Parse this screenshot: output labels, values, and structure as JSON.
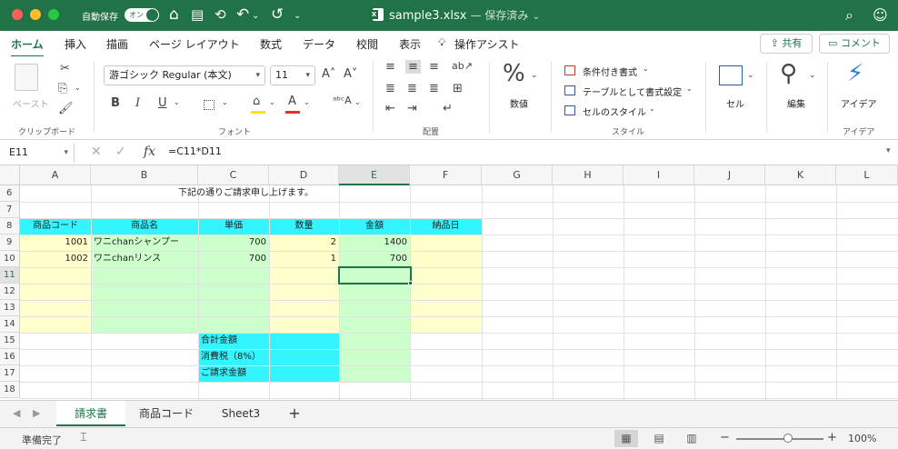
{
  "titlebar": {
    "autosave_label": "自動保存",
    "autosave_state": "オン",
    "filename": "sample3.xlsx",
    "saved_status": "— 保存済み",
    "saved_caret": "⌄"
  },
  "tabs": [
    {
      "label": "ホーム",
      "active": true
    },
    {
      "label": "挿入"
    },
    {
      "label": "描画"
    },
    {
      "label": "ページ レイアウト"
    },
    {
      "label": "数式"
    },
    {
      "label": "データ"
    },
    {
      "label": "校閲"
    },
    {
      "label": "表示"
    },
    {
      "label": "操作アシスト"
    }
  ],
  "share_label": "共有",
  "comment_label": "コメント",
  "ribbon": {
    "paste_label": "ペースト",
    "clipboard_label": "クリップボード",
    "font_name": "游ゴシック Regular (本文)",
    "font_size": "11",
    "font_label": "フォント",
    "bold": "B",
    "italic": "I",
    "underline": "U",
    "align_label": "配置",
    "number_label": "数値",
    "percent_symbol": "%",
    "cond_format": "条件付き書式",
    "table_format": "テーブルとして書式設定",
    "cell_style": "セルのスタイル",
    "style_label": "スタイル",
    "cells_label": "セル",
    "edit_label": "編集",
    "ideas_label": "アイデア",
    "ideas_group_label": "アイデア"
  },
  "formula_bar": {
    "name_box": "E11",
    "formula": "=C11*D11"
  },
  "columns": [
    "A",
    "B",
    "C",
    "D",
    "E",
    "F",
    "G",
    "H",
    "I",
    "J",
    "K",
    "L"
  ],
  "selected_column": "E",
  "rows": [
    "6",
    "7",
    "8",
    "9",
    "10",
    "11",
    "12",
    "13",
    "14",
    "15",
    "16",
    "17",
    "18"
  ],
  "selected_row": "11",
  "cells": {
    "notice": "下記の通りご請求申し上げます。",
    "hdr_code": "商品コード",
    "hdr_name": "商品名",
    "hdr_price": "単価",
    "hdr_qty": "数量",
    "hdr_amount": "金額",
    "hdr_date": "納品日",
    "r9_code": "1001",
    "r9_name": "ワニchanシャンプー",
    "r9_price": "700",
    "r9_qty": "2",
    "r9_amount": "1400",
    "r10_code": "1002",
    "r10_name": "ワニchanリンス",
    "r10_price": "700",
    "r10_qty": "1",
    "r10_amount": "700",
    "subtotal": "合計金額",
    "tax": "消費税（8%）",
    "total": "ご請求金額"
  },
  "sheets": [
    {
      "label": "請求書",
      "active": true
    },
    {
      "label": "商品コード"
    },
    {
      "label": "Sheet3"
    }
  ],
  "add_sheet": "+",
  "status": {
    "ready": "準備完了",
    "zoom": "100%",
    "zoom_fraction": 0.55
  },
  "colors": {
    "accent": "#207346",
    "header_fill": "#33f5ff",
    "yellow_fill": "#ffffcc",
    "green_fill": "#ccffcc"
  }
}
